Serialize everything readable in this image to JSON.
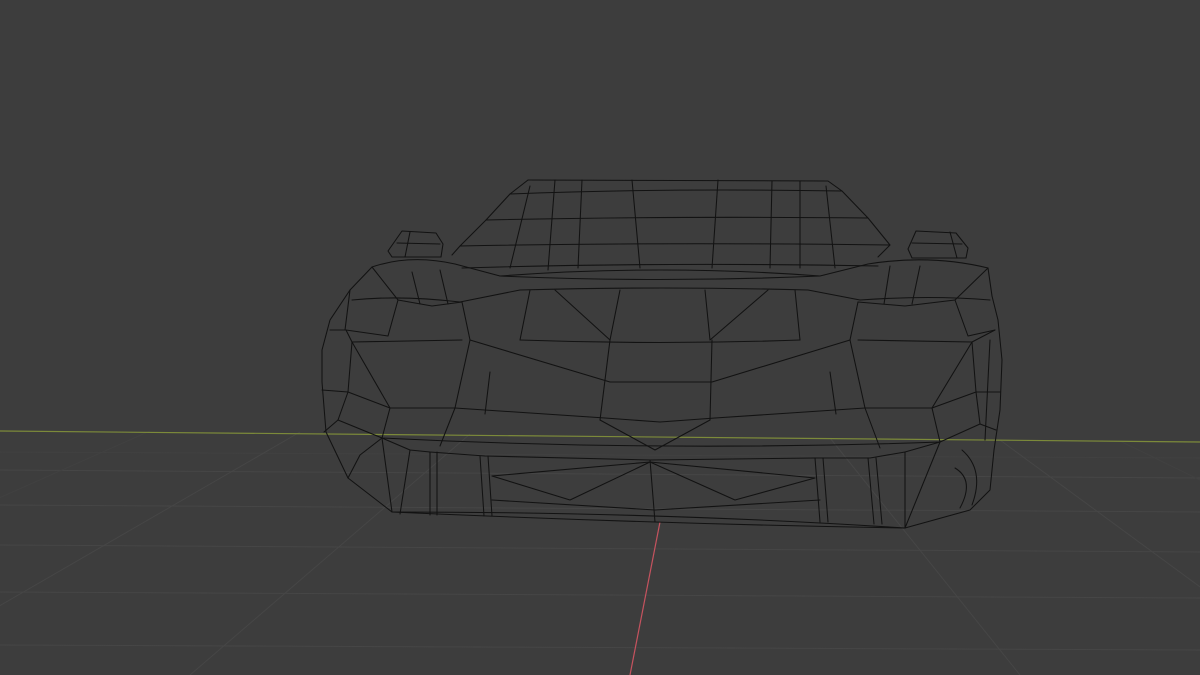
{
  "viewport": {
    "background_color": "#3d3d3d",
    "grid_color": "#464646",
    "x_axis_color": "#c6535f",
    "y_axis_color": "#7c8a3a",
    "wireframe_color": "#121212",
    "object": "car-wireframe",
    "view": "perspective-front",
    "shading": "wireframe"
  }
}
